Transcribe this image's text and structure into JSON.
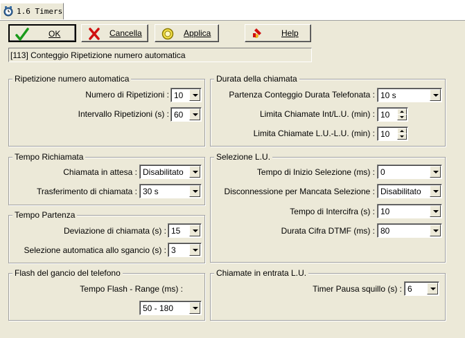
{
  "tab": {
    "label": "1.6 Timers",
    "icon": "timer-clock-icon"
  },
  "toolbar": {
    "ok": {
      "label": "OK",
      "icon": "green-checkmark-icon"
    },
    "cancel": {
      "label": "Cancella",
      "icon": "red-x-icon"
    },
    "apply": {
      "label": "Applica",
      "icon": "yellow-circle-icon"
    },
    "help": {
      "label": "Help",
      "icon": "help-icon"
    }
  },
  "description": "[113] Conteggio Ripetizione numero automatica",
  "groups": {
    "ripetizione": {
      "title": "Ripetizione numero automatica",
      "numero_label": "Numero di Ripetizioni :",
      "numero_value": "10",
      "intervallo_label": "Intervallo Ripetizioni (s) :",
      "intervallo_value": "60"
    },
    "durata": {
      "title": "Durata della chiamata",
      "partenza_label": "Partenza Conteggio Durata Telefonata :",
      "partenza_value": "10 s",
      "int_label": "Limita Chiamate Int/L.U. (min) :",
      "int_value": "10",
      "lu_label": "Limita Chiamate L.U.-L.U. (min) :",
      "lu_value": "10"
    },
    "richiamata": {
      "title": "Tempo Richiamata",
      "attesa_label": "Chiamata in attesa :",
      "attesa_value": "Disabilitato",
      "trasf_label": "Trasferimento di chiamata :",
      "trasf_value": "30 s"
    },
    "selezione": {
      "title": "Selezione L.U.",
      "inizio_label": "Tempo di Inizio Selezione (ms) :",
      "inizio_value": "0",
      "disc_label": "Disconnessione per Mancata Selezione :",
      "disc_value": "Disabilitato",
      "intercifra_label": "Tempo di Intercifra (s) :",
      "intercifra_value": "10",
      "dtmf_label": "Durata Cifra DTMF (ms) :",
      "dtmf_value": "80"
    },
    "partenza": {
      "title": "Tempo Partenza",
      "deviazione_label": "Deviazione di chiamata (s) :",
      "deviazione_value": "15",
      "sgancio_label": "Selezione automatica allo sgancio (s) :",
      "sgancio_value": "3"
    },
    "flash": {
      "title": "Flash del gancio del telefono",
      "range_label": "Tempo Flash - Range (ms) :",
      "range_value": "50 - 180"
    },
    "entrata": {
      "title": "Chiamate in entrata L.U.",
      "pausa_label": "Timer Pausa squillo (s) :",
      "pausa_value": "6"
    }
  }
}
